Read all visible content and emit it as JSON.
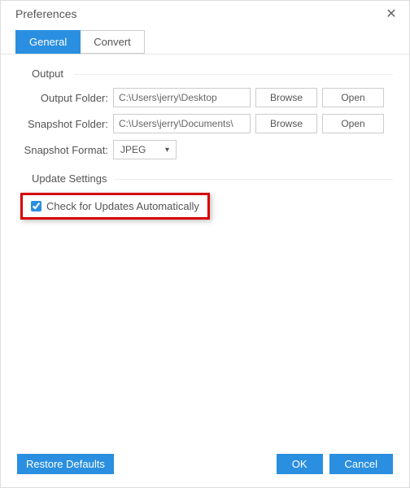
{
  "window": {
    "title": "Preferences"
  },
  "tabs": {
    "general": "General",
    "convert": "Convert"
  },
  "sections": {
    "output": {
      "title": "Output",
      "output_folder_label": "Output Folder:",
      "output_folder_value": "C:\\Users\\jerry\\Desktop",
      "snapshot_folder_label": "Snapshot Folder:",
      "snapshot_folder_value": "C:\\Users\\jerry\\Documents\\",
      "snapshot_format_label": "Snapshot Format:",
      "snapshot_format_value": "JPEG",
      "browse_label": "Browse",
      "open_label": "Open"
    },
    "update": {
      "title": "Update Settings",
      "checkbox_label": "Check for Updates Automatically",
      "checkbox_checked": true
    }
  },
  "footer": {
    "restore": "Restore Defaults",
    "ok": "OK",
    "cancel": "Cancel"
  }
}
